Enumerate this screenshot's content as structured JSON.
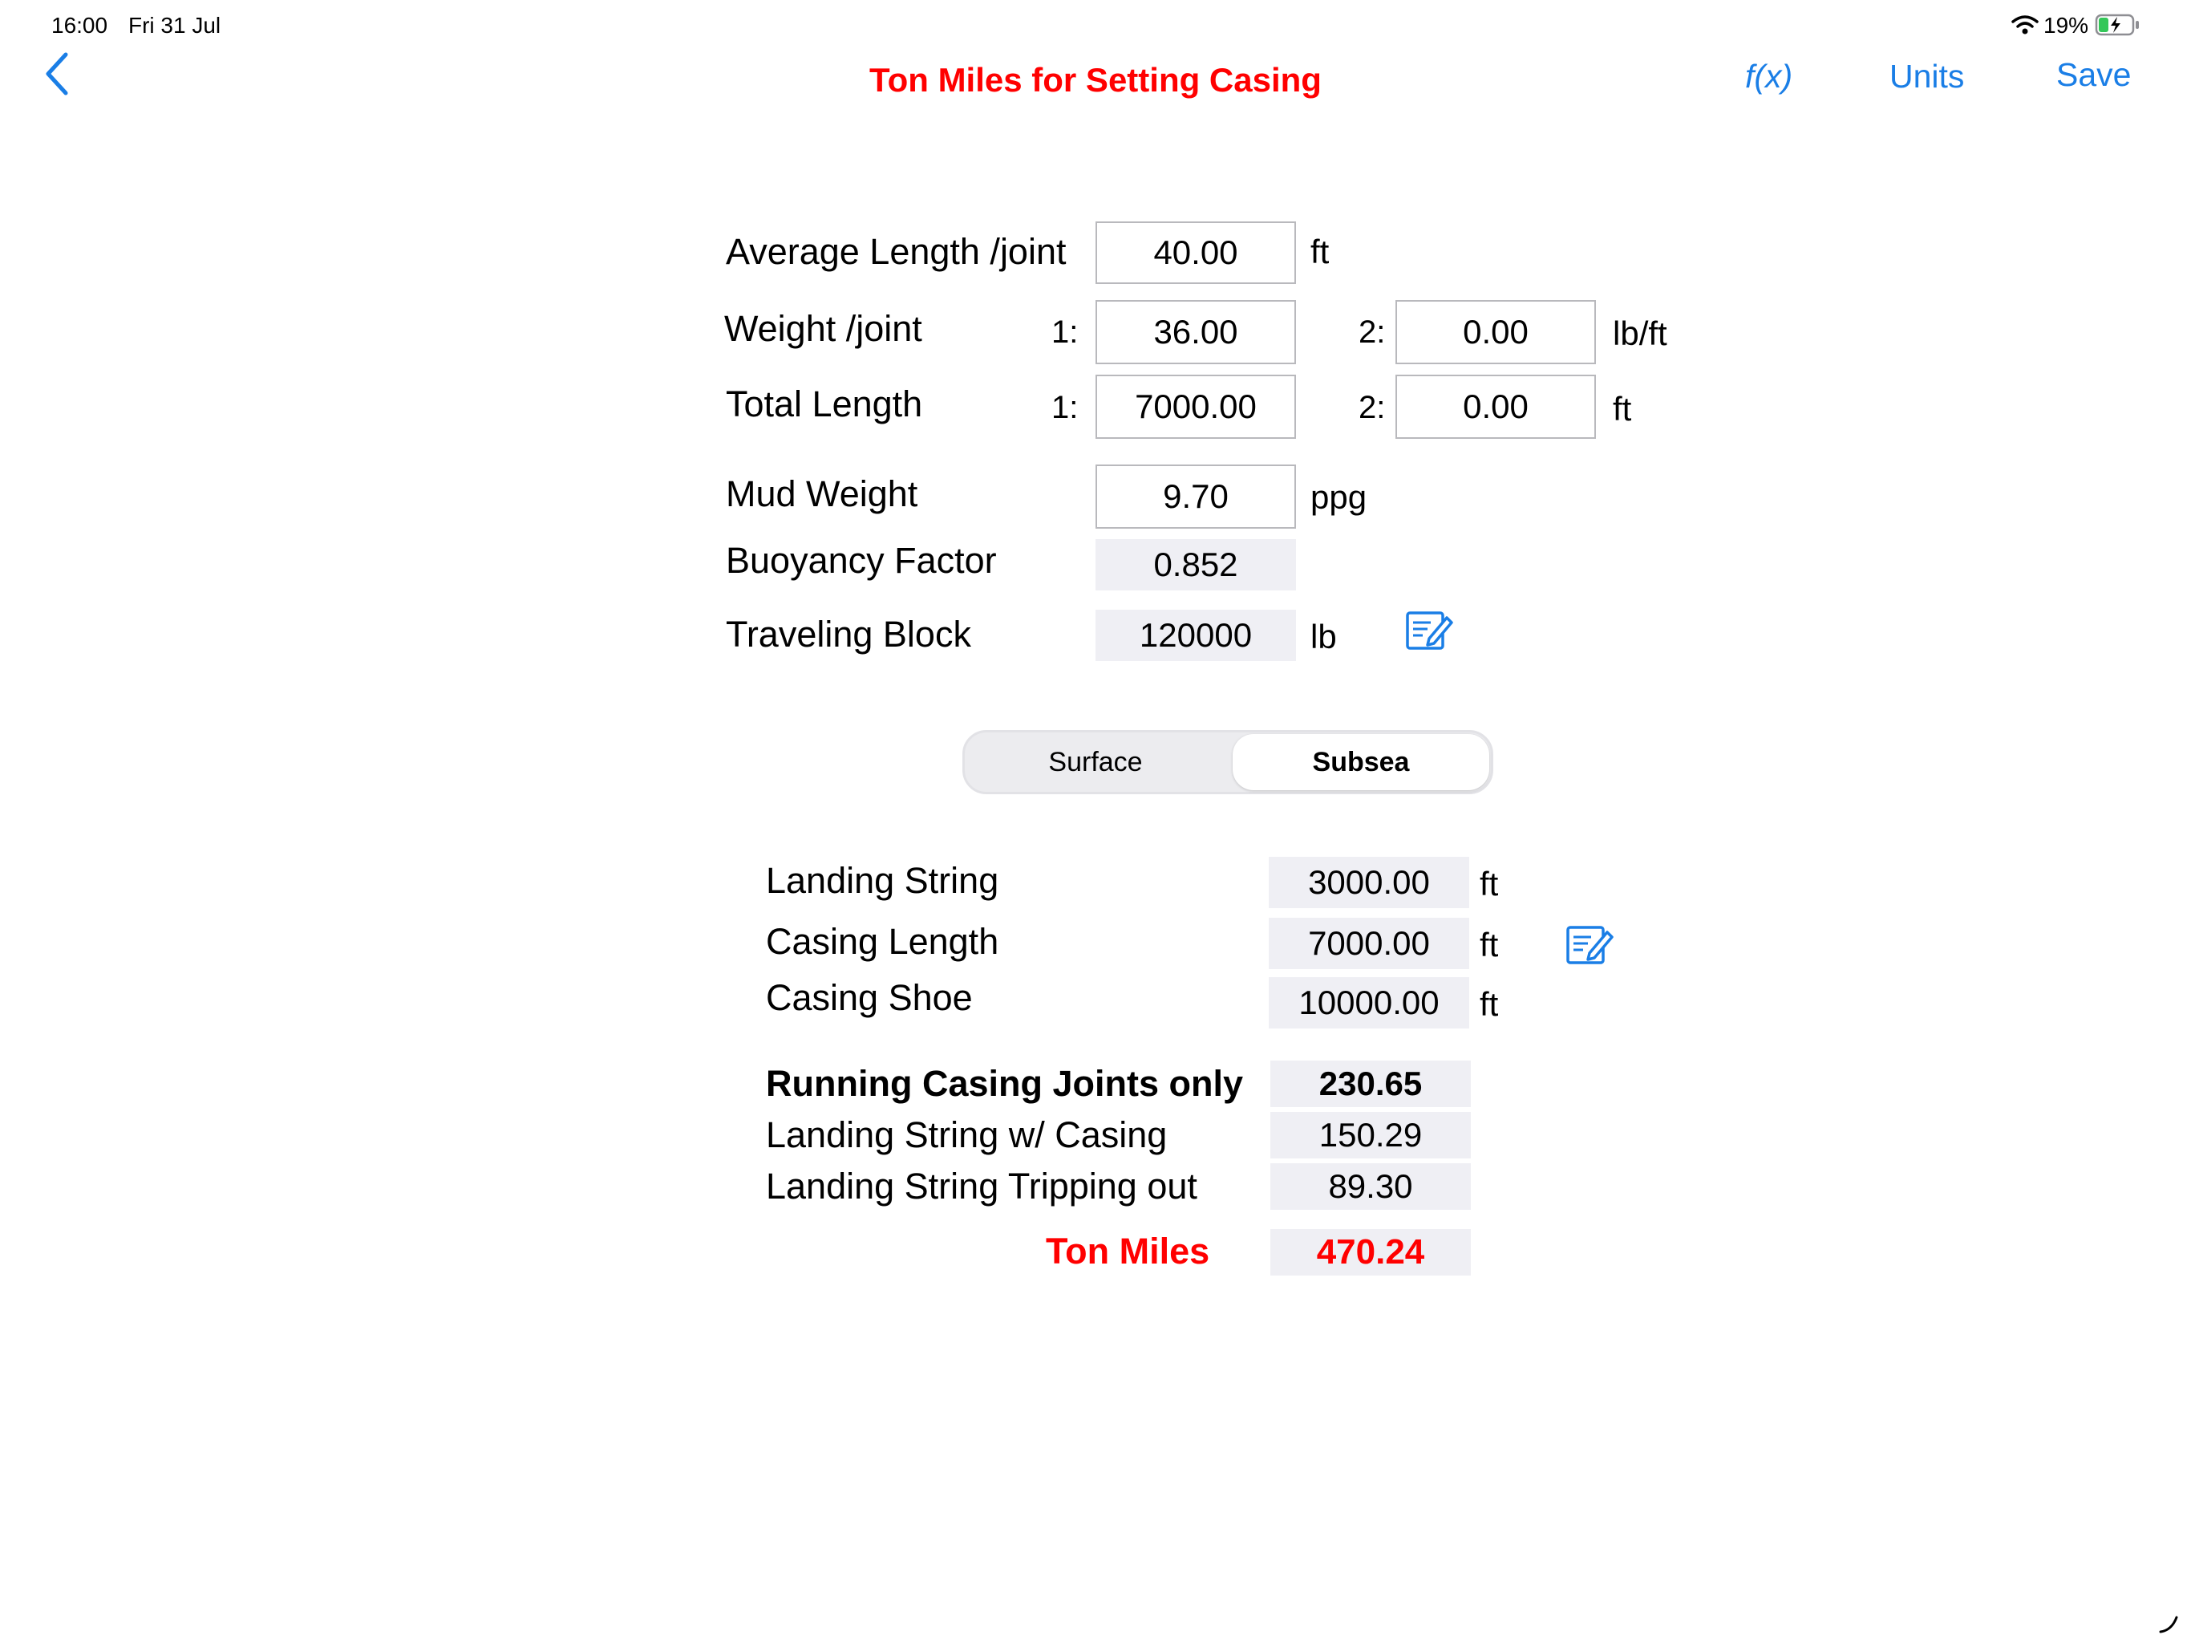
{
  "status_bar": {
    "time": "16:00",
    "date": "Fri 31 Jul",
    "battery_percent": "19%",
    "wifi_icon": "wifi-icon",
    "battery_icon": "battery-charging-icon"
  },
  "nav": {
    "title": "Ton Miles for Setting Casing",
    "back_icon": "chevron-left-icon",
    "fx_label": "f(x)",
    "units_label": "Units",
    "save_label": "Save"
  },
  "inputs": {
    "avg_length": {
      "label": "Average Length /joint",
      "value": "40.00",
      "unit": "ft"
    },
    "weight": {
      "label": "Weight /joint",
      "idx1": "1:",
      "value1": "36.00",
      "idx2": "2:",
      "value2": "0.00",
      "unit": "lb/ft"
    },
    "total_length": {
      "label": "Total Length",
      "idx1": "1:",
      "value1": "7000.00",
      "idx2": "2:",
      "value2": "0.00",
      "unit": "ft"
    },
    "mud_weight": {
      "label": "Mud Weight",
      "value": "9.70",
      "unit": "ppg"
    },
    "buoyancy": {
      "label": "Buoyancy Factor",
      "value": "0.852"
    },
    "traveling_block": {
      "label": "Traveling Block",
      "value": "120000",
      "unit": "lb",
      "edit_icon": "edit-note-icon"
    }
  },
  "segment": {
    "options": [
      "Surface",
      "Subsea"
    ],
    "selected": "Subsea"
  },
  "subsea": {
    "landing_string": {
      "label": "Landing String",
      "value": "3000.00",
      "unit": "ft"
    },
    "casing_length": {
      "label": "Casing Length",
      "value": "7000.00",
      "unit": "ft",
      "edit_icon": "edit-note-icon"
    },
    "casing_shoe": {
      "label": "Casing Shoe",
      "value": "10000.00",
      "unit": "ft"
    }
  },
  "results": {
    "running_casing": {
      "label": "Running Casing Joints only",
      "value": "230.65"
    },
    "landing_with_casing": {
      "label": "Landing String w/ Casing",
      "value": "150.29"
    },
    "landing_tripping_out": {
      "label": "Landing String Tripping out",
      "value": "89.30"
    },
    "ton_miles": {
      "label": "Ton Miles",
      "value": "470.24"
    }
  },
  "colors": {
    "accent": "#1a7ee6",
    "title_red": "#ff0000",
    "readonly_bg": "#efeff4"
  }
}
